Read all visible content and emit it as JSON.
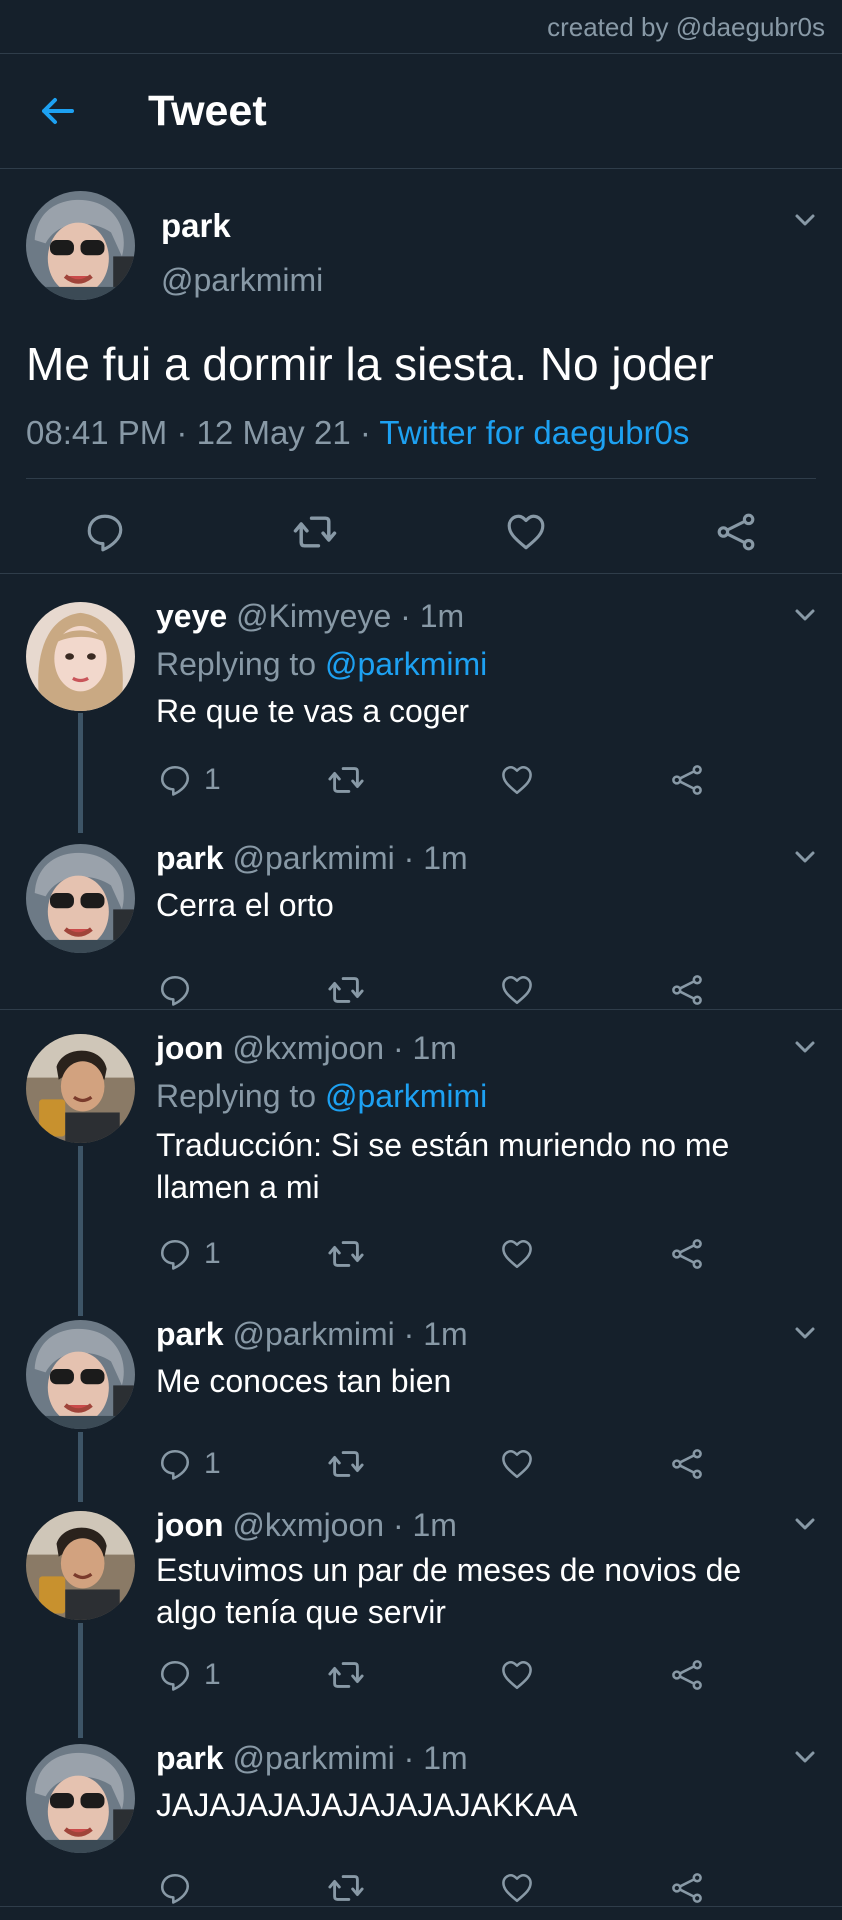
{
  "header": {
    "credit": "created by @daegubr0s",
    "title": "Tweet"
  },
  "colors": {
    "background": "#15202b",
    "accent": "#1da1f2",
    "muted": "#8899a6",
    "divider": "#2f3d4a"
  },
  "main_tweet": {
    "name": "park",
    "handle": "@parkmimi",
    "text": "Me fui a dormir la siesta. No joder",
    "time": "08:41 PM · 12 May 21 · ",
    "source": "Twitter for daegubr0s"
  },
  "replies": [
    {
      "name": "yeye",
      "handle": "@Kimyeye · 1m",
      "replying_prefix": "Replying to ",
      "replying_to": "@parkmimi",
      "text": "Re que te vas a coger",
      "reply_count": "1"
    },
    {
      "name": "park",
      "handle": "@parkmimi · 1m",
      "text": "Cerra el orto",
      "reply_count": ""
    },
    {
      "name": "joon",
      "handle": "@kxmjoon · 1m",
      "replying_prefix": "Replying to ",
      "replying_to": "@parkmimi",
      "text": "Traducción: Si se están muriendo no me llamen a mi",
      "reply_count": "1"
    },
    {
      "name": "park",
      "handle": "@parkmimi · 1m",
      "text": "Me conoces tan bien",
      "reply_count": "1"
    },
    {
      "name": "joon",
      "handle": "@kxmjoon · 1m",
      "text": "Estuvimos un par de meses de novios de algo tenía que servir",
      "reply_count": "1"
    },
    {
      "name": "park",
      "handle": "@parkmimi · 1m",
      "text": "JAJAJAJAJAJAJAJAJAKKAA",
      "reply_count": ""
    }
  ],
  "icons": [
    "back-arrow-icon",
    "chevron-down-icon",
    "reply-icon",
    "retweet-icon",
    "like-icon",
    "share-icon"
  ]
}
